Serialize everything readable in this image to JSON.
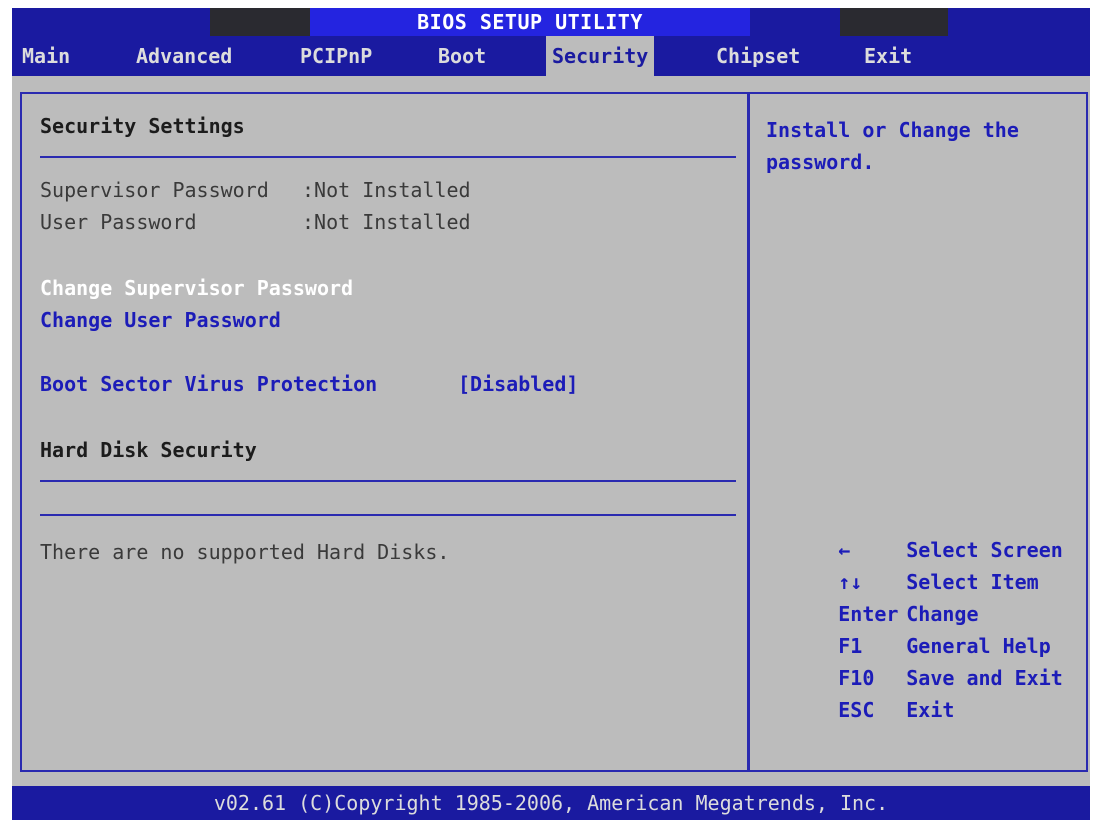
{
  "title": "BIOS SETUP UTILITY",
  "menu": {
    "items": [
      "Main",
      "Advanced",
      "PCIPnP",
      "Boot",
      "Security",
      "Chipset",
      "Exit"
    ],
    "active": "Security"
  },
  "main": {
    "section_title": "Security Settings",
    "supervisor_label": "Supervisor Password",
    "supervisor_value": ":Not Installed",
    "user_label": "User Password",
    "user_value": ":Not Installed",
    "change_supervisor": "Change Supervisor Password",
    "change_user": "Change User Password",
    "boot_virus_label": "Boot Sector Virus Protection",
    "boot_virus_value": "[Disabled]",
    "hdd_title": "Hard Disk Security",
    "hdd_message": "There are no supported Hard Disks."
  },
  "help": {
    "text": "Install or Change the password.",
    "keys": [
      {
        "key": "←",
        "action": "Select Screen"
      },
      {
        "key": "↑↓",
        "action": "Select Item"
      },
      {
        "key": "Enter",
        "action": "Change"
      },
      {
        "key": "F1",
        "action": "General Help"
      },
      {
        "key": "F10",
        "action": "Save and Exit"
      },
      {
        "key": "ESC",
        "action": "Exit"
      }
    ]
  },
  "footer": "v02.61 (C)Copyright 1985-2006, American Megatrends, Inc."
}
